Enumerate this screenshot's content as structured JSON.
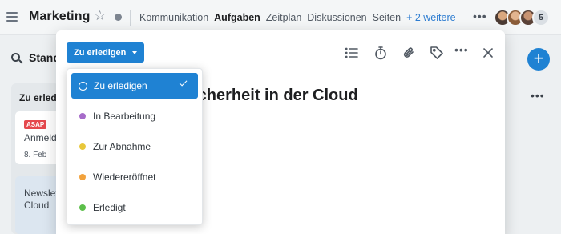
{
  "header": {
    "title": "Marketing",
    "tabs": [
      {
        "label": "Kommunikation",
        "active": false
      },
      {
        "label": "Aufgaben",
        "active": true
      },
      {
        "label": "Zeitplan",
        "active": false
      },
      {
        "label": "Diskussionen",
        "active": false
      },
      {
        "label": "Seiten",
        "active": false
      }
    ],
    "more_label": "+ 2 weitere",
    "overflow_label": "•••",
    "member_count": "5"
  },
  "board": {
    "view_title": "Stand",
    "column_title": "Zu erled",
    "card1": {
      "badge": "ASAP",
      "title": "Anmeld",
      "date": "8. Feb"
    },
    "card2": {
      "title": "Newslet Cloud"
    },
    "fab_label": "+",
    "column_menu": "•••"
  },
  "modal": {
    "status_label": "Zu erledigen",
    "title": "sicherheit in der Cloud",
    "toolbar_overflow": "•••"
  },
  "status_menu": {
    "options": [
      {
        "label": "Zu erledigen",
        "selected": true,
        "color": "#1f82d3"
      },
      {
        "label": "In Bearbeitung",
        "selected": false,
        "color": "#a66bc9"
      },
      {
        "label": "Zur Abnahme",
        "selected": false,
        "color": "#e8c73a"
      },
      {
        "label": "Wiedereröffnet",
        "selected": false,
        "color": "#f2a23c"
      },
      {
        "label": "Erledigt",
        "selected": false,
        "color": "#5cbf4a"
      }
    ]
  },
  "colors": {
    "accent": "#1f82d3",
    "link": "#2e7dd1",
    "asap": "#e5484d"
  }
}
